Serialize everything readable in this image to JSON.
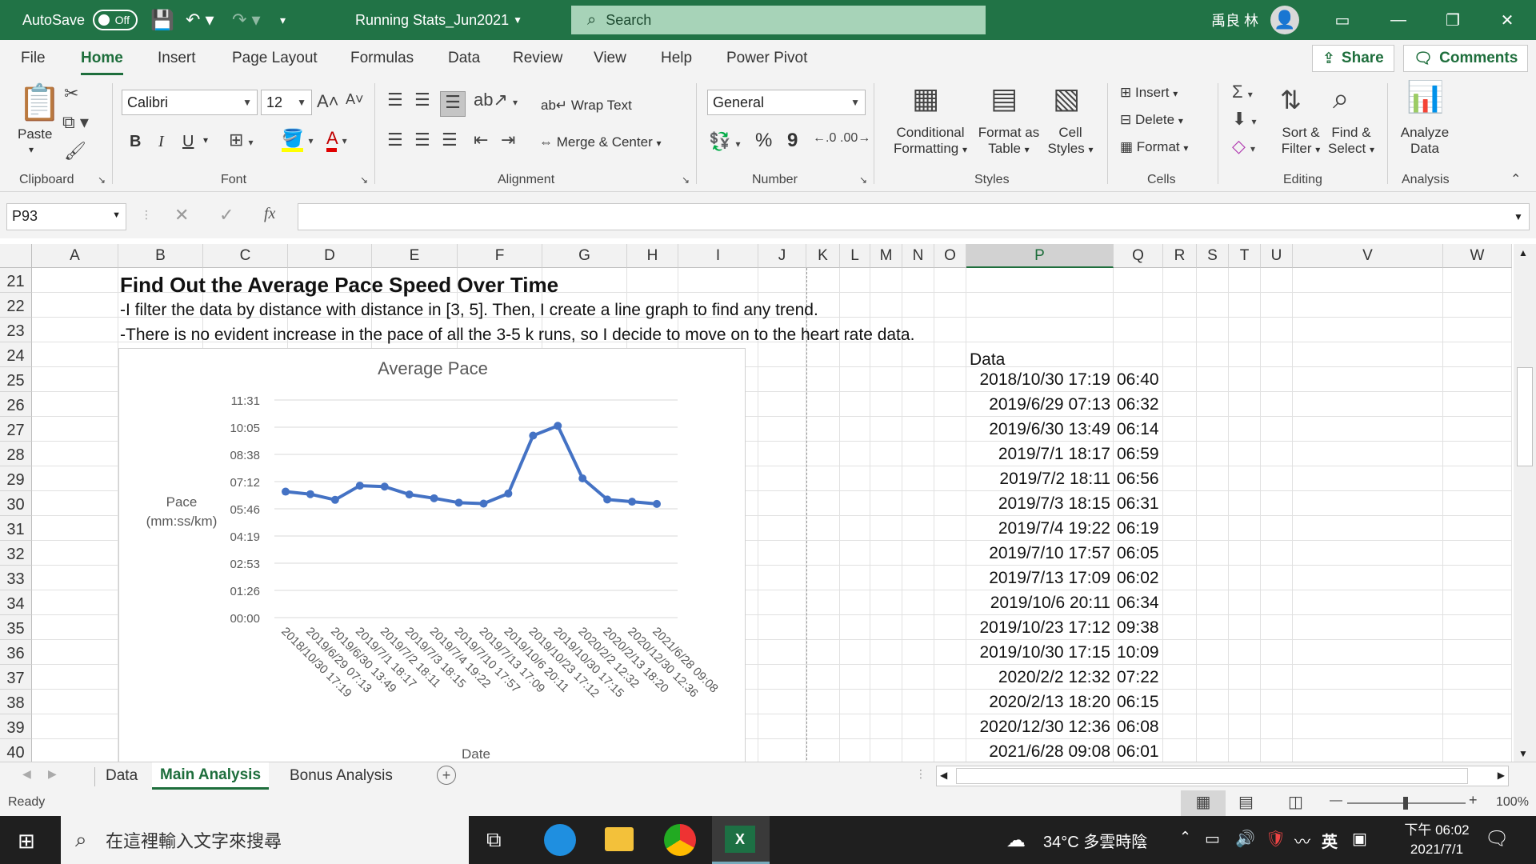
{
  "titlebar": {
    "autosave_label": "AutoSave",
    "autosave_state": "Off",
    "filename": "Running Stats_Jun2021",
    "search_placeholder": "Search",
    "user_name": "禹良 林",
    "accent_color": "#217346"
  },
  "menu": {
    "tabs": [
      "File",
      "Home",
      "Insert",
      "Page Layout",
      "Formulas",
      "Data",
      "Review",
      "View",
      "Help",
      "Power Pivot"
    ],
    "active_tab": "Home",
    "share_label": "Share",
    "comments_label": "Comments"
  },
  "ribbon": {
    "clipboard": {
      "paste": "Paste",
      "group": "Clipboard"
    },
    "font": {
      "family": "Calibri",
      "size": "12",
      "group": "Font",
      "bold": "B",
      "italic": "I",
      "underline": "U"
    },
    "alignment": {
      "wrap_text": "Wrap Text",
      "merge_center": "Merge & Center",
      "group": "Alignment"
    },
    "number": {
      "format": "General",
      "group": "Number",
      "percent": "%",
      "comma": "9"
    },
    "styles": {
      "conditional": "Conditional",
      "formatting": "Formatting",
      "format_as": "Format as",
      "table": "Table",
      "cell": "Cell",
      "cell_styles": "Styles",
      "group": "Styles"
    },
    "cells": {
      "insert": "Insert",
      "delete": "Delete",
      "format": "Format",
      "group": "Cells"
    },
    "editing": {
      "sort": "Sort &",
      "filter": "Filter",
      "find": "Find &",
      "select": "Select",
      "group": "Editing"
    },
    "analysis": {
      "analyze": "Analyze",
      "data": "Data",
      "group": "Analysis"
    }
  },
  "formula_bar": {
    "name_box": "P93",
    "fx": "fx",
    "value": ""
  },
  "columns": [
    "A",
    "B",
    "C",
    "D",
    "E",
    "F",
    "G",
    "H",
    "I",
    "J",
    "K",
    "L",
    "M",
    "N",
    "O",
    "P",
    "Q",
    "R",
    "S",
    "T",
    "U",
    "V",
    "W"
  ],
  "selected_column": "P",
  "rows": [
    "21",
    "22",
    "23",
    "24",
    "25",
    "26",
    "27",
    "28",
    "29",
    "30",
    "31",
    "32",
    "33",
    "34",
    "35",
    "36",
    "37",
    "38",
    "39",
    "40"
  ],
  "sheet": {
    "heading": "Find Out the Average Pace Speed Over Time",
    "line1": "-I filter the data by distance with distance in [3, 5]. Then, I create a line graph to find any trend.",
    "line2": "-There is no evident increase in the pace of all the 3-5 k runs, so I decide to move on to the heart rate data.",
    "data_header": "Data",
    "data_table": [
      {
        "date": "2018/10/30 17:19",
        "pace": "06:40"
      },
      {
        "date": "2019/6/29 07:13",
        "pace": "06:32"
      },
      {
        "date": "2019/6/30 13:49",
        "pace": "06:14"
      },
      {
        "date": "2019/7/1 18:17",
        "pace": "06:59"
      },
      {
        "date": "2019/7/2 18:11",
        "pace": "06:56"
      },
      {
        "date": "2019/7/3 18:15",
        "pace": "06:31"
      },
      {
        "date": "2019/7/4 19:22",
        "pace": "06:19"
      },
      {
        "date": "2019/7/10 17:57",
        "pace": "06:05"
      },
      {
        "date": "2019/7/13 17:09",
        "pace": "06:02"
      },
      {
        "date": "2019/10/6 20:11",
        "pace": "06:34"
      },
      {
        "date": "2019/10/23 17:12",
        "pace": "09:38"
      },
      {
        "date": "2019/10/30 17:15",
        "pace": "10:09"
      },
      {
        "date": "2020/2/2 12:32",
        "pace": "07:22"
      },
      {
        "date": "2020/2/13 18:20",
        "pace": "06:15"
      },
      {
        "date": "2020/12/30 12:36",
        "pace": "06:08"
      },
      {
        "date": "2021/6/28 09:08",
        "pace": "06:01"
      }
    ]
  },
  "chart_data": {
    "type": "line",
    "title": "Average Pace",
    "xlabel": "Date",
    "ylabel": "Pace (mm:ss/km)",
    "y_ticks": [
      "00:00",
      "01:26",
      "02:53",
      "04:19",
      "05:46",
      "07:12",
      "08:38",
      "10:05",
      "11:31"
    ],
    "ylim": [
      0,
      691
    ],
    "grid": true,
    "line_color": "#4472c4",
    "categories": [
      "2018/10/30 17:19",
      "2019/6/29 07:13",
      "2019/6/30 13:49",
      "2019/7/1 18:17",
      "2019/7/2 18:11",
      "2019/7/3 18:15",
      "2019/7/4 19:22",
      "2019/7/10 17:57",
      "2019/7/13 17:09",
      "2019/10/6 20:11",
      "2019/10/23 17:12",
      "2019/10/30 17:15",
      "2020/2/2 12:32",
      "2020/2/13 18:20",
      "2020/12/30 12:36",
      "2021/6/28 09:08"
    ],
    "values": [
      400,
      392,
      374,
      419,
      416,
      391,
      379,
      365,
      362,
      394,
      578,
      609,
      442,
      375,
      368,
      361
    ]
  },
  "sheet_tabs": [
    "Data",
    "Main Analysis",
    "Bonus Analysis"
  ],
  "active_sheet": "Main Analysis",
  "status": {
    "ready": "Ready",
    "zoom": "100%"
  },
  "taskbar": {
    "search_placeholder": "在這裡輸入文字來搜尋",
    "weather": "34°C 多雲時陰",
    "ime": "英",
    "time": "下午 06:02",
    "date": "2021/7/1"
  }
}
